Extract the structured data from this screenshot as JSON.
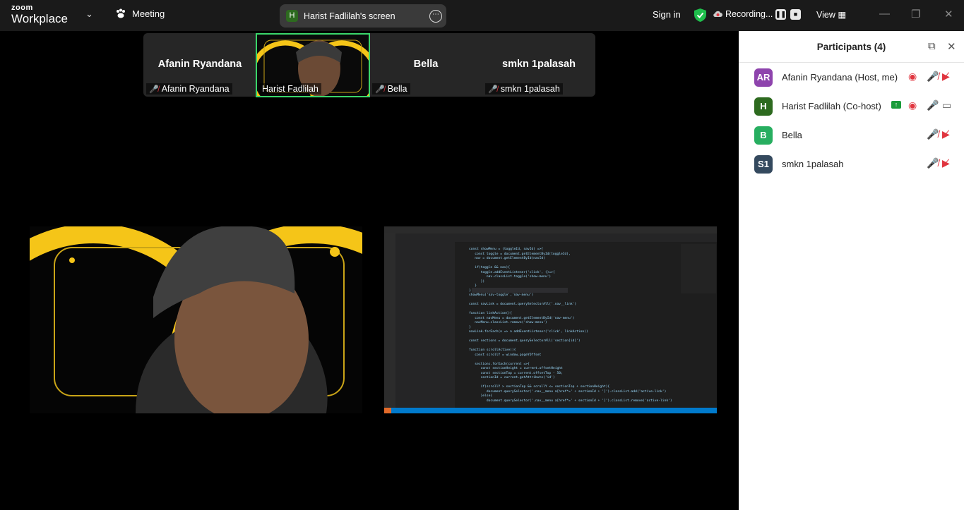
{
  "titlebar": {
    "logo_top": "zoom",
    "logo_bottom": "Workplace",
    "meeting_label": "Meeting",
    "share_initial": "H",
    "share_label": "Harist Fadlilah's screen",
    "sign_in": "Sign in",
    "recording": "Recording...",
    "view": "View"
  },
  "strip": {
    "tiles": [
      {
        "big": "Afanin Ryandana",
        "label": "Afanin Ryandana"
      },
      {
        "big": "",
        "label": "Harist Fadlilah"
      },
      {
        "big": "Bella",
        "label": "Bella"
      },
      {
        "big": "smkn 1palasah",
        "label": "smkn 1palasah"
      }
    ]
  },
  "panel": {
    "title": "Participants (4)",
    "participants": [
      {
        "initials": "AR",
        "name": "Afanin Ryandana (Host, me)",
        "color": "#8e44ad"
      },
      {
        "initials": "H",
        "name": "Harist Fadlilah (Co-host)",
        "color": "#2d6a1f"
      },
      {
        "initials": "B",
        "name": "Bella",
        "color": "#27ae60"
      },
      {
        "initials": "S1",
        "name": "smkn 1palasah",
        "color": "#34495e"
      }
    ]
  },
  "code_lines": [
    "const showMenu = (toggleId, navId) =>{",
    "   const toggle = document.getElementById(toggleId),",
    "   nav = document.getElementById(navId)",
    "",
    "   if(toggle && nav){",
    "      toggle.addEventListener('click', ()=>{",
    "         nav.classList.toggle('show-menu')",
    "      })",
    "   }",
    "}",
    "showMenu('nav-toggle','nav-menu')",
    "",
    "const navLink = document.querySelectorAll('.nav__link')",
    "",
    "function linkAction(){",
    "   const navMenu = document.getElementById('nav-menu')",
    "   navMenu.classList.remove('show-menu')",
    "}",
    "navLink.forEach(n => n.addEventListener('click', linkAction))",
    "",
    "const sections = document.querySelectorAll('section[id]')",
    "",
    "function scrollActive(){",
    "   const scrollY = window.pageYOffset",
    "",
    "   sections.forEach(current =>{",
    "      const sectionHeight = current.offsetHeight",
    "      const sectionTop = current.offsetTop - 50;",
    "      sectionId = current.getAttribute('id')",
    "",
    "      if(scrollY > sectionTop && scrollY <= sectionTop + sectionHeight){",
    "         document.querySelector('.nav__menu a[href*=' + sectionId + ']').classList.add('active-link')",
    "      }else{",
    "         document.querySelector('.nav__menu a[href*=' + sectionId + ']').classList.remove('active-link')"
  ]
}
